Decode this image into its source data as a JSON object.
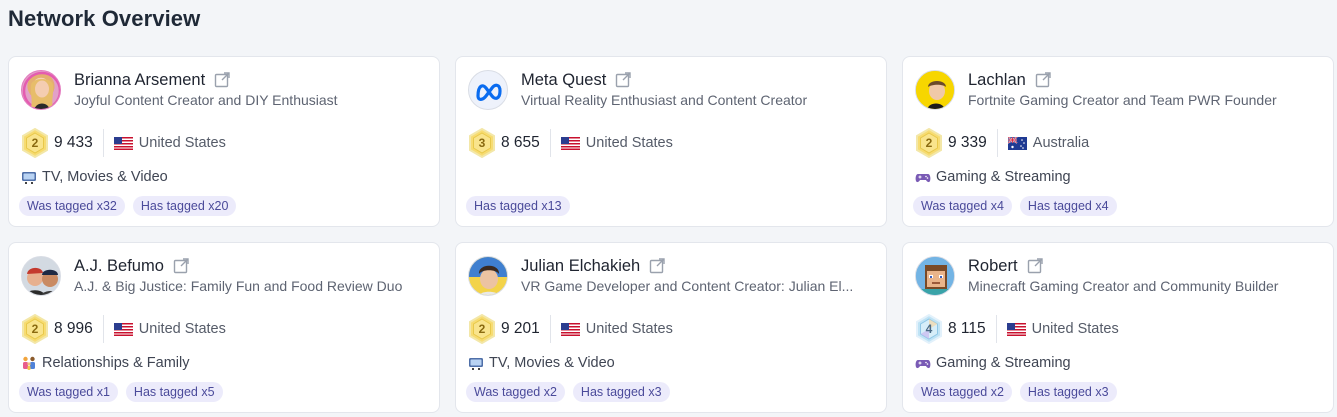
{
  "page": {
    "title": "Network Overview"
  },
  "colors": {
    "tag_bg": "#ecebfb",
    "tag_text": "#4a4a9a",
    "badge_gold": "#f6d86a"
  },
  "cards": [
    {
      "name": "Brianna Arsement",
      "description": "Joyful Content Creator and DIY Enthusiast",
      "level": "2",
      "score": "9 433",
      "country": "United States",
      "flag": "us-flag",
      "category": "TV, Movies & Video",
      "category_icon": "tv-icon",
      "tags": [
        "Was tagged x32",
        "Has tagged x20"
      ]
    },
    {
      "name": "Meta Quest",
      "description": "Virtual Reality Enthusiast and Content Creator",
      "level": "3",
      "score": "8 655",
      "country": "United States",
      "flag": "us-flag",
      "category": "",
      "category_icon": "",
      "tags": [
        "Has tagged x13"
      ]
    },
    {
      "name": "Lachlan",
      "description": "Fortnite Gaming Creator and Team PWR Founder",
      "level": "2",
      "score": "9 339",
      "country": "Australia",
      "flag": "au-flag",
      "category": "Gaming & Streaming",
      "category_icon": "gamepad-icon",
      "tags": [
        "Was tagged x4",
        "Has tagged x4"
      ]
    },
    {
      "name": "A.J. Befumo",
      "description": "A.J. & Big Justice: Family Fun and Food Review Duo",
      "level": "2",
      "score": "8 996",
      "country": "United States",
      "flag": "us-flag",
      "category": "Relationships & Family",
      "category_icon": "family-icon",
      "tags": [
        "Was tagged x1",
        "Has tagged x5"
      ]
    },
    {
      "name": "Julian Elchakieh",
      "description": "VR Game Developer and Content Creator: Julian El...",
      "level": "2",
      "score": "9 201",
      "country": "United States",
      "flag": "us-flag",
      "category": "TV, Movies & Video",
      "category_icon": "tv-icon",
      "tags": [
        "Was tagged x2",
        "Has tagged x3"
      ]
    },
    {
      "name": "Robert",
      "description": "Minecraft Gaming Creator and Community Builder",
      "level": "4",
      "score": "8 115",
      "country": "United States",
      "flag": "us-flag",
      "category": "Gaming & Streaming",
      "category_icon": "gamepad-icon",
      "tags": [
        "Was tagged x2",
        "Has tagged x3"
      ]
    }
  ]
}
